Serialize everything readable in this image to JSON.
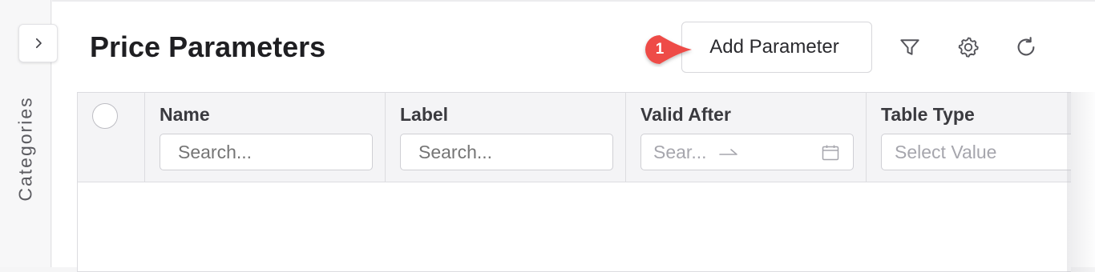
{
  "sidebar": {
    "label": "Categories",
    "expand_icon": "chevron-right-icon"
  },
  "header": {
    "title": "Price Parameters",
    "add_button_label": "Add Parameter",
    "callout_number": "1",
    "callout_color": "#ee4b47",
    "toolbar_icons": [
      "filter-icon",
      "settings-gear-icon",
      "refresh-icon"
    ]
  },
  "grid": {
    "columns": [
      {
        "title": "Name",
        "filter_type": "text",
        "placeholder": "Search..."
      },
      {
        "title": "Label",
        "filter_type": "text",
        "placeholder": "Search..."
      },
      {
        "title": "Valid After",
        "filter_type": "date-range",
        "placeholder": "Sear..."
      },
      {
        "title": "Table Type",
        "filter_type": "select",
        "placeholder": "Select Value"
      }
    ],
    "rows": []
  }
}
